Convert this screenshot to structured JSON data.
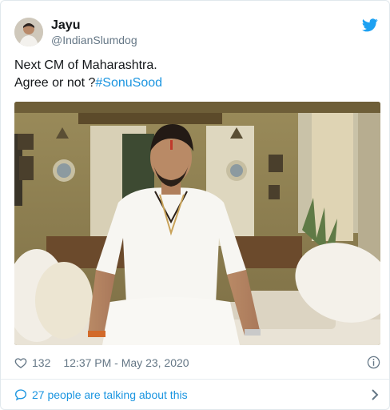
{
  "user": {
    "display_name": "Jayu",
    "handle": "@IndianSlumdog",
    "avatar_icon": "profile-avatar"
  },
  "tweet": {
    "line1": "Next CM of Maharashtra.",
    "line2_prefix": "Agree or not ?",
    "hashtag": "#SonuSood"
  },
  "media": {
    "alt": "photo"
  },
  "meta": {
    "like_count": "132",
    "timestamp": "12:37 PM - May 23, 2020"
  },
  "footer": {
    "conversation_text": "27 people are talking about this"
  },
  "colors": {
    "link": "#1b95e0",
    "secondary": "#657786",
    "text": "#14171a",
    "twitter_blue": "#1da1f2"
  },
  "icons": [
    "twitter-logo-icon",
    "heart-icon",
    "info-icon",
    "speech-bubble-icon",
    "chevron-right-icon"
  ]
}
